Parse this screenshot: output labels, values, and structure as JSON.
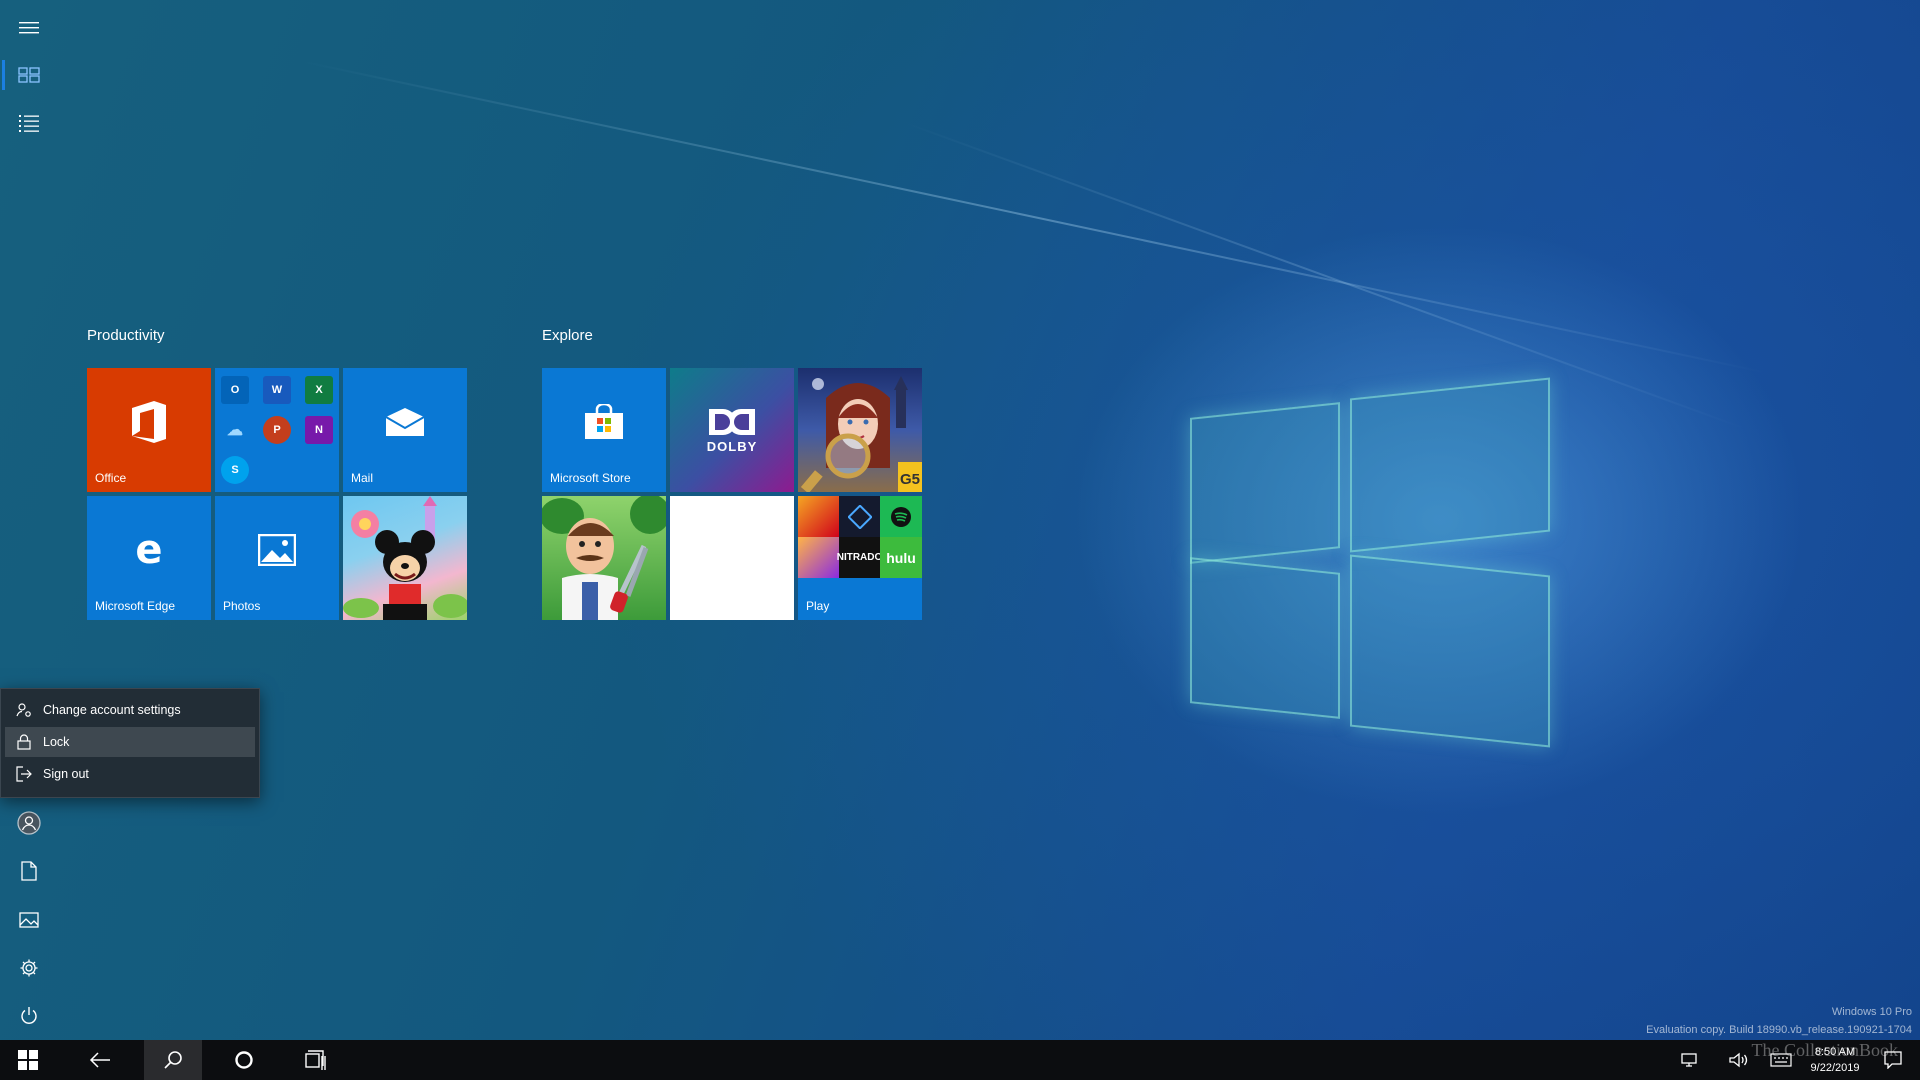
{
  "groups": [
    {
      "title": "Productivity"
    },
    {
      "title": "Explore"
    }
  ],
  "tiles": {
    "office": "Office",
    "mail": "Mail",
    "edge": "Microsoft Edge",
    "photos": "Photos",
    "store": "Microsoft Store",
    "play": "Play",
    "dolby": "DOLBY",
    "g5": "G5",
    "nitrado": "NITRADO",
    "hulu": "hulu"
  },
  "office_apps": {
    "outlook": "O",
    "word": "W",
    "excel": "X",
    "onedrive": "☁",
    "powerpoint": "P",
    "onenote": "N",
    "skype": "S"
  },
  "flyout": {
    "change_account": "Change account settings",
    "lock": "Lock",
    "sign_out": "Sign out"
  },
  "system": {
    "edition": "Windows 10 Pro",
    "build": "Evaluation copy. Build 18990.vb_release.190921-1704",
    "time": "8:50 AM",
    "date": "9/22/2019",
    "brand_watermark": "The CollectionBook"
  },
  "colors": {
    "accent": "#0a78d4",
    "office_tile": "#d83b01",
    "taskbar": "#0c0d10"
  }
}
